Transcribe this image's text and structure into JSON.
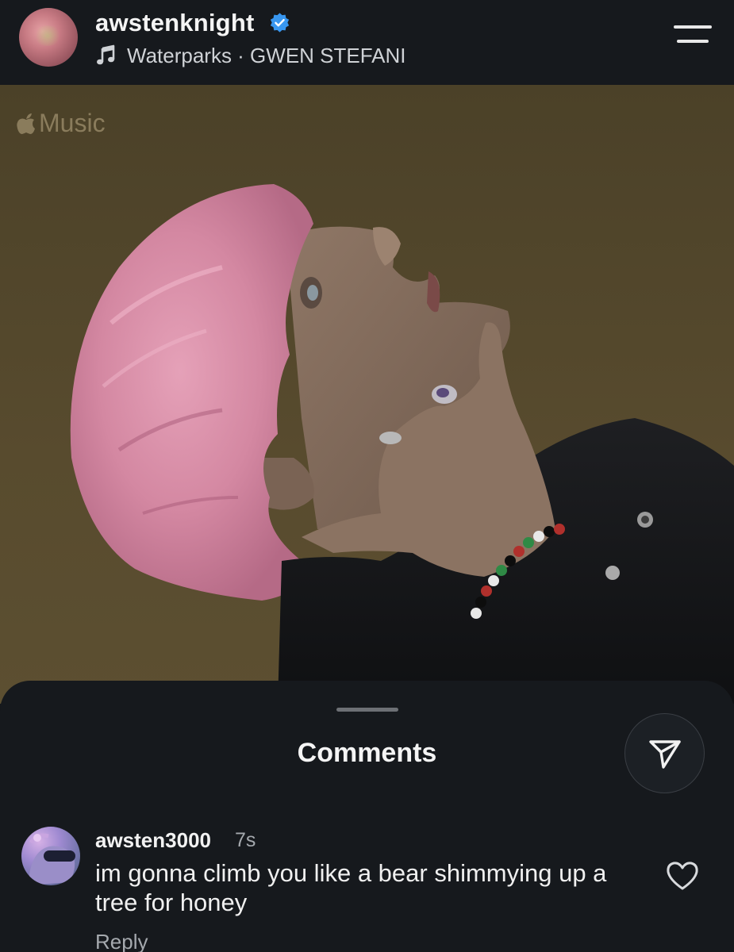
{
  "header": {
    "username": "awstenknight",
    "verified": true,
    "song": "Waterparks · GWEN STEFANI",
    "music_icon": "music-note-icon",
    "menu_icon": "menu-icon"
  },
  "media": {
    "badge_text": "Music",
    "badge_icon": "apple-logo-icon"
  },
  "comments": {
    "title": "Comments",
    "send_icon": "send-icon",
    "items": [
      {
        "author": "awsten3000",
        "time": "7s",
        "text": "im gonna climb you like a bear shimmying up a tree for honey",
        "reply_label": "Reply",
        "like_icon": "heart-icon"
      }
    ]
  },
  "colors": {
    "background": "#16191d",
    "text": "#f2f2f2",
    "muted": "#a5a9ae",
    "verified_blue": "#3897f0",
    "photo_backdrop": "#584b2e",
    "hair_pink": "#d98aa4"
  }
}
